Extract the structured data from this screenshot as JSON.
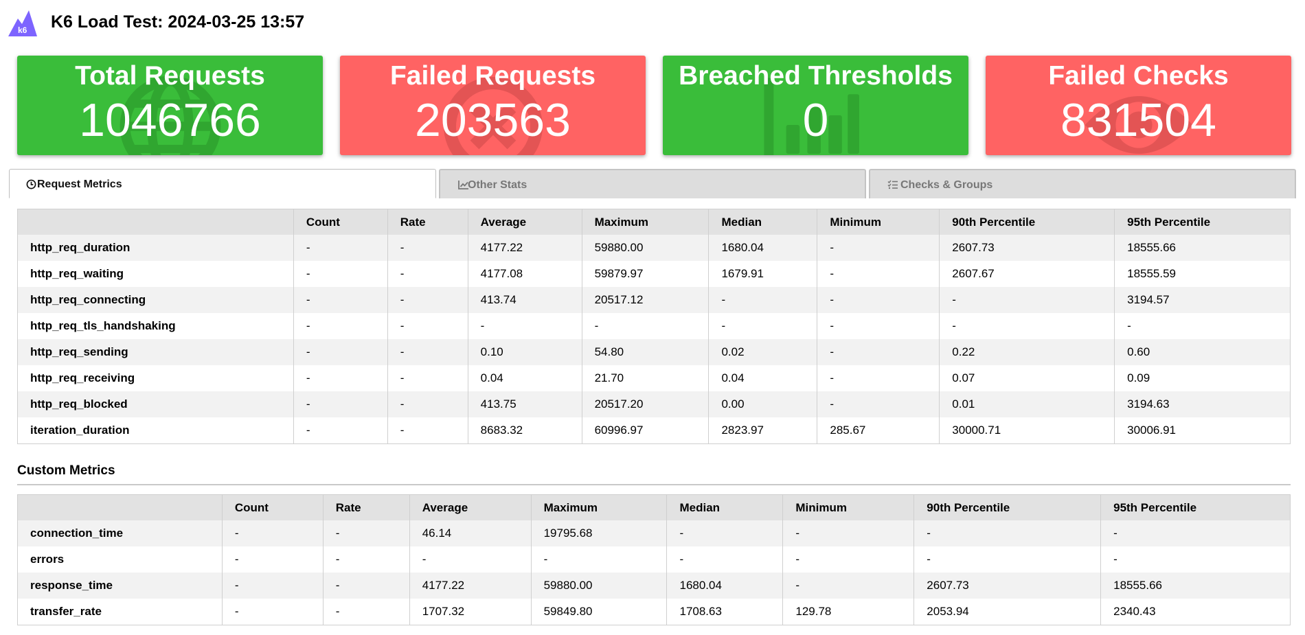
{
  "header": {
    "title": "K6 Load Test: 2024-03-25 13:57",
    "logo_text": "k6",
    "logo_color": "#7d64ff"
  },
  "cards": [
    {
      "title": "Total Requests",
      "value": "1046766",
      "color": "#3abd3a",
      "icon": "globe-icon"
    },
    {
      "title": "Failed Requests",
      "value": "203563",
      "color": "#ff6363",
      "icon": "times-circle-icon"
    },
    {
      "title": "Breached Thresholds",
      "value": "0",
      "color": "#3abd3a",
      "icon": "bar-chart-icon"
    },
    {
      "title": "Failed Checks",
      "value": "831504",
      "color": "#ff6363",
      "icon": "eye-icon"
    }
  ],
  "tabs": [
    {
      "label": "Request Metrics",
      "icon": "clock-icon",
      "active": true
    },
    {
      "label": "Other Stats",
      "icon": "line-chart-icon",
      "active": false
    },
    {
      "label": "Checks & Groups",
      "icon": "tasks-icon",
      "active": false
    }
  ],
  "request_metrics": {
    "columns": [
      "",
      "Count",
      "Rate",
      "Average",
      "Maximum",
      "Median",
      "Minimum",
      "90th Percentile",
      "95th Percentile"
    ],
    "rows": [
      [
        "http_req_duration",
        "-",
        "-",
        "4177.22",
        "59880.00",
        "1680.04",
        "-",
        "2607.73",
        "18555.66"
      ],
      [
        "http_req_waiting",
        "-",
        "-",
        "4177.08",
        "59879.97",
        "1679.91",
        "-",
        "2607.67",
        "18555.59"
      ],
      [
        "http_req_connecting",
        "-",
        "-",
        "413.74",
        "20517.12",
        "-",
        "-",
        "-",
        "3194.57"
      ],
      [
        "http_req_tls_handshaking",
        "-",
        "-",
        "-",
        "-",
        "-",
        "-",
        "-",
        "-"
      ],
      [
        "http_req_sending",
        "-",
        "-",
        "0.10",
        "54.80",
        "0.02",
        "-",
        "0.22",
        "0.60"
      ],
      [
        "http_req_receiving",
        "-",
        "-",
        "0.04",
        "21.70",
        "0.04",
        "-",
        "0.07",
        "0.09"
      ],
      [
        "http_req_blocked",
        "-",
        "-",
        "413.75",
        "20517.20",
        "0.00",
        "-",
        "0.01",
        "3194.63"
      ],
      [
        "iteration_duration",
        "-",
        "-",
        "8683.32",
        "60996.97",
        "2823.97",
        "285.67",
        "30000.71",
        "30006.91"
      ]
    ]
  },
  "custom_metrics": {
    "title": "Custom Metrics",
    "columns": [
      "",
      "Count",
      "Rate",
      "Average",
      "Maximum",
      "Median",
      "Minimum",
      "90th Percentile",
      "95th Percentile"
    ],
    "rows": [
      [
        "connection_time",
        "-",
        "-",
        "46.14",
        "19795.68",
        "-",
        "-",
        "-",
        "-"
      ],
      [
        "errors",
        "-",
        "-",
        "-",
        "-",
        "-",
        "-",
        "-",
        "-"
      ],
      [
        "response_time",
        "-",
        "-",
        "4177.22",
        "59880.00",
        "1680.04",
        "-",
        "2607.73",
        "18555.66"
      ],
      [
        "transfer_rate",
        "-",
        "-",
        "1707.32",
        "59849.80",
        "1708.63",
        "129.78",
        "2053.94",
        "2340.43"
      ]
    ]
  }
}
